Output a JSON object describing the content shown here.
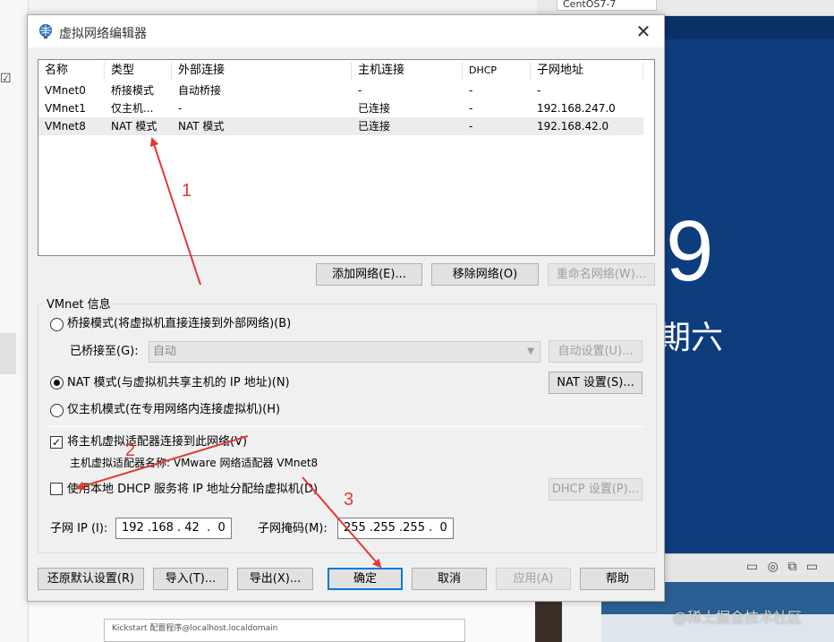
{
  "background": {
    "vm_tab_label": "CentOS7-7",
    "clock_digit": "9",
    "day_text": "期六",
    "bottom_window_title": "Kickstart 配置程序@localhost.localdomain",
    "watermark": "@稀土掘金技术社区",
    "status_icons": "▭ ◎ ⧉ ▭"
  },
  "dialog": {
    "title": "虚拟网络编辑器",
    "close_label": "✕",
    "list": {
      "headers": [
        "名称",
        "类型",
        "外部连接",
        "主机连接",
        "DHCP",
        "子网地址"
      ],
      "rows": [
        [
          "VMnet0",
          "桥接模式",
          "自动桥接",
          "-",
          "-",
          "-"
        ],
        [
          "VMnet1",
          "仅主机...",
          "-",
          "已连接",
          "-",
          "192.168.247.0"
        ],
        [
          "VMnet8",
          "NAT 模式",
          "NAT 模式",
          "已连接",
          "-",
          "192.168.42.0"
        ]
      ]
    },
    "list_buttons": {
      "add": "添加网络(E)...",
      "remove": "移除网络(O)",
      "rename": "重命名网络(W)..."
    },
    "vmnet_info": {
      "legend": "VMnet 信息",
      "bridged_radio": "桥接模式(将虚拟机直接连接到外部网络)(B)",
      "bridged_to_label": "已桥接至(G):",
      "bridged_to_value": "自动",
      "auto_settings": "自动设置(U)...",
      "nat_radio": "NAT 模式(与虚拟机共享主机的 IP 地址)(N)",
      "nat_settings": "NAT 设置(S)...",
      "hostonly_radio": "仅主机模式(在专用网络内连接虚拟机)(H)",
      "connect_adapter": "将主机虚拟适配器连接到此网络(V)",
      "adapter_name": "主机虚拟适配器名称: VMware 网络适配器 VMnet8",
      "use_dhcp": "使用本地 DHCP 服务将 IP 地址分配给虚拟机(D)",
      "dhcp_settings": "DHCP 设置(P)...",
      "subnet_ip_label": "子网 IP (I):",
      "subnet_ip": "192 .168 . 42  .  0",
      "subnet_mask_label": "子网掩码(M):",
      "subnet_mask": "255 .255 .255 .  0"
    },
    "bottom_buttons": {
      "restore": "还原默认设置(R)",
      "import": "导入(T)...",
      "export": "导出(X)...",
      "ok": "确定",
      "cancel": "取消",
      "apply": "应用(A)",
      "help": "帮助"
    }
  },
  "annotations": {
    "color": "#e23a36",
    "labels": [
      "1",
      "2",
      "3"
    ]
  }
}
